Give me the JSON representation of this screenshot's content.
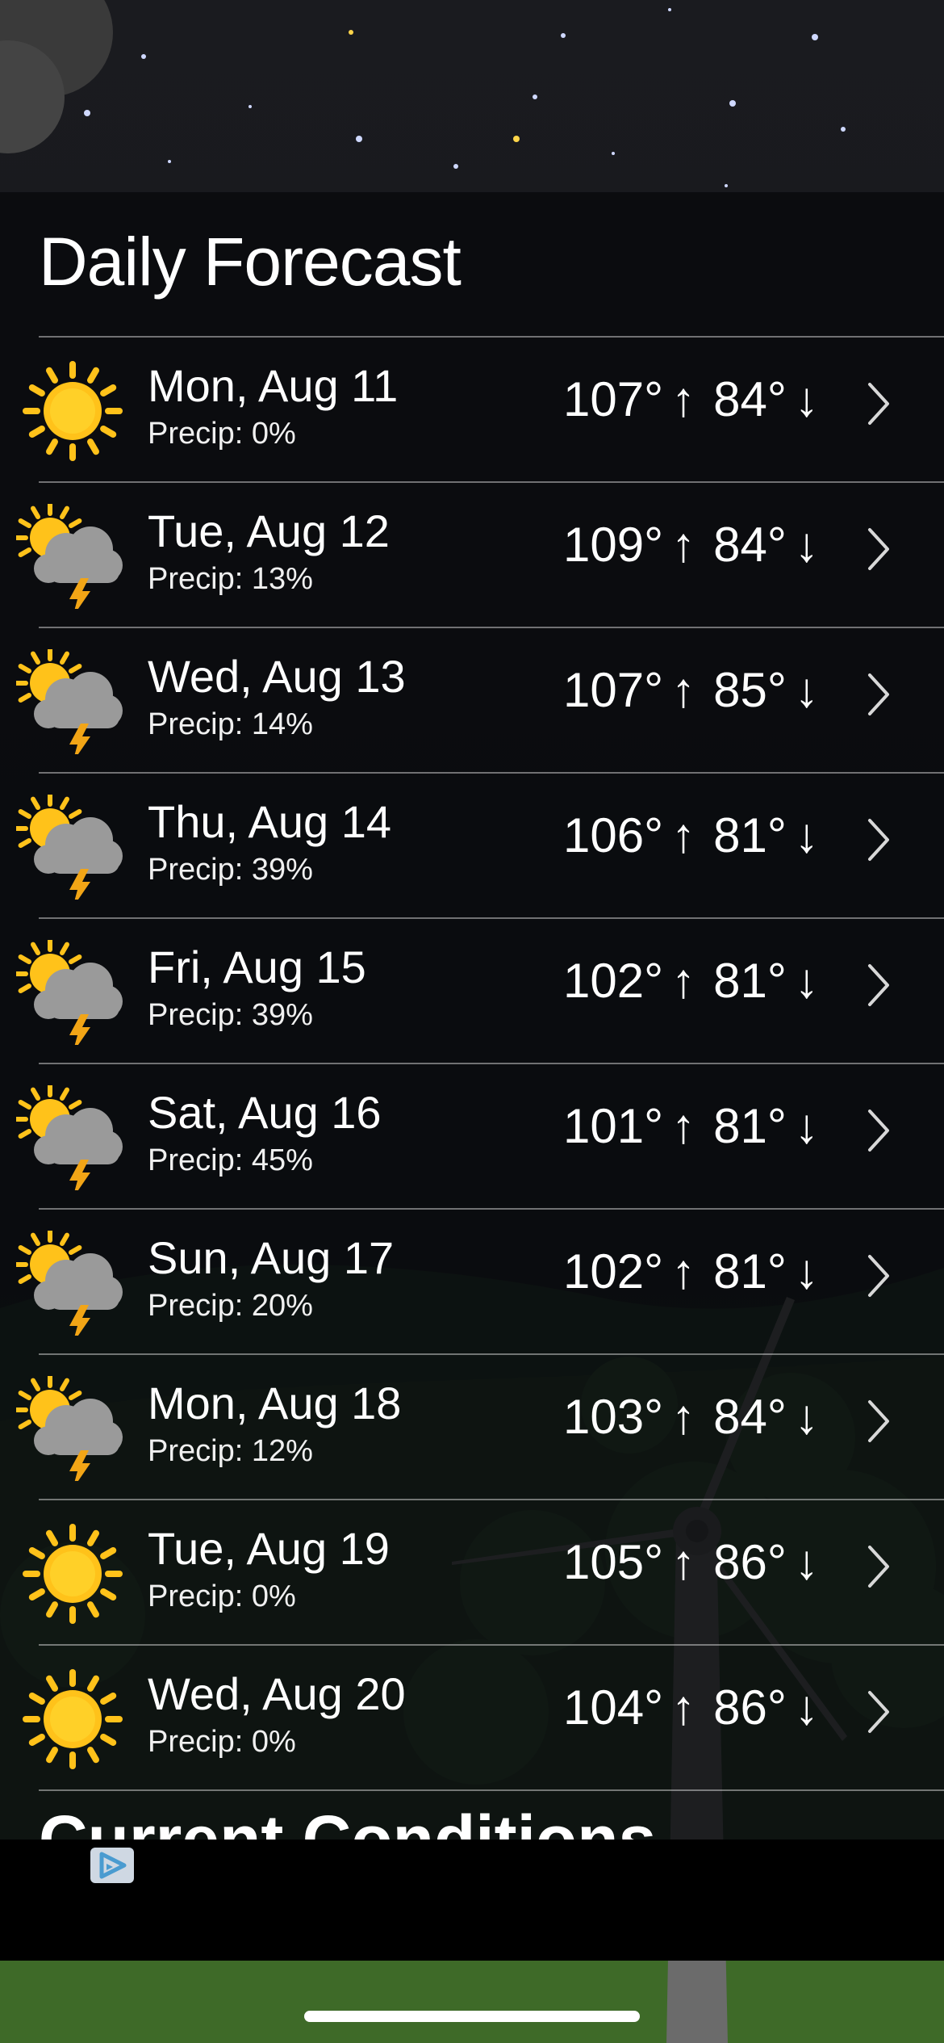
{
  "forecast": {
    "title": "Daily Forecast",
    "days": [
      {
        "date": "Mon, Aug 11",
        "precip": "Precip: 0%",
        "high": "107°",
        "low": "84°",
        "icon": "sun-icon"
      },
      {
        "date": "Tue, Aug 12",
        "precip": "Precip: 13%",
        "high": "109°",
        "low": "84°",
        "icon": "thunderstorm-icon"
      },
      {
        "date": "Wed, Aug 13",
        "precip": "Precip: 14%",
        "high": "107°",
        "low": "85°",
        "icon": "thunderstorm-icon"
      },
      {
        "date": "Thu, Aug 14",
        "precip": "Precip: 39%",
        "high": "106°",
        "low": "81°",
        "icon": "thunderstorm-icon"
      },
      {
        "date": "Fri, Aug 15",
        "precip": "Precip: 39%",
        "high": "102°",
        "low": "81°",
        "icon": "thunderstorm-icon"
      },
      {
        "date": "Sat, Aug 16",
        "precip": "Precip: 45%",
        "high": "101°",
        "low": "81°",
        "icon": "thunderstorm-icon"
      },
      {
        "date": "Sun, Aug 17",
        "precip": "Precip: 20%",
        "high": "102°",
        "low": "81°",
        "icon": "thunderstorm-icon"
      },
      {
        "date": "Mon, Aug 18",
        "precip": "Precip: 12%",
        "high": "103°",
        "low": "84°",
        "icon": "thunderstorm-icon"
      },
      {
        "date": "Tue, Aug 19",
        "precip": "Precip: 0%",
        "high": "105°",
        "low": "86°",
        "icon": "sun-icon"
      },
      {
        "date": "Wed, Aug 20",
        "precip": "Precip: 0%",
        "high": "104°",
        "low": "86°",
        "icon": "sun-icon"
      }
    ],
    "arrow_up": "↑",
    "arrow_down": "↓"
  },
  "current_conditions": {
    "title": "Current Conditions"
  },
  "ad": {
    "icon": "ad-choices-icon"
  },
  "colors": {
    "sun": "#FFC21A",
    "sun_center": "#FFD028",
    "cloud": "#9A9A9A",
    "bolt": "#F2A516",
    "panel": "#08090C",
    "ad_icon": "#4A9BD0"
  }
}
